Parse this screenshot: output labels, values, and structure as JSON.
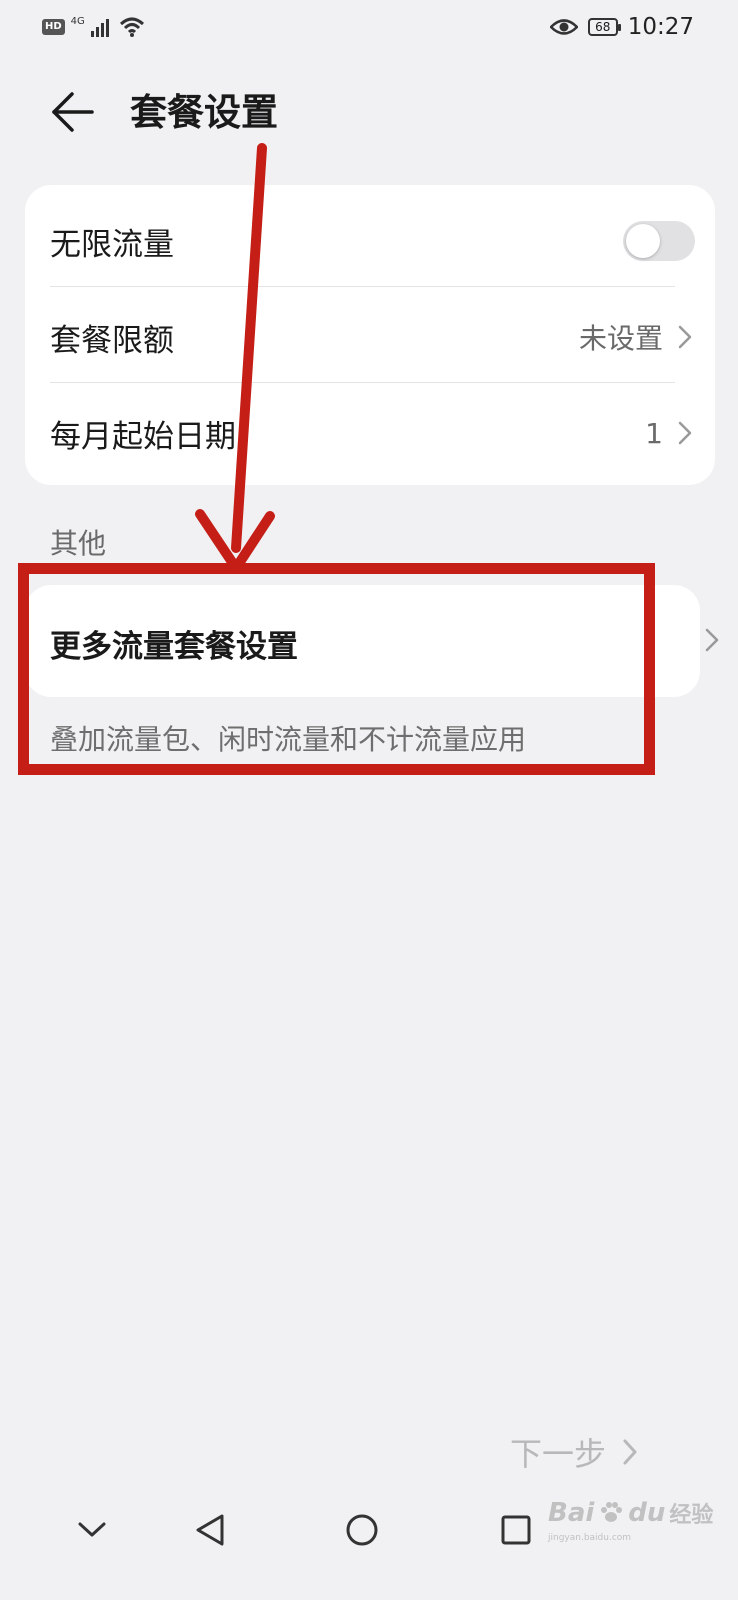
{
  "status_bar": {
    "hd": "HD",
    "network": "4G",
    "battery": "68",
    "time": "10:27",
    "icons": [
      "hd-icon",
      "signal-icon",
      "wifi-icon",
      "eye-icon",
      "battery-icon"
    ]
  },
  "header": {
    "back_icon": "back-arrow-icon",
    "title": "套餐设置"
  },
  "main_card": {
    "unlimited": {
      "label": "无限流量",
      "toggle_on": false
    },
    "quota": {
      "label": "套餐限额",
      "value": "未设置"
    },
    "start_date": {
      "label": "每月起始日期",
      "value": "1"
    }
  },
  "other_section": {
    "title": "其他",
    "more_settings": {
      "label": "更多流量套餐设置",
      "description": "叠加流量包、闲时流量和不计流量应用"
    }
  },
  "next_button": {
    "label": "下一步"
  },
  "annotation": {
    "arrow_color": "#c41e16",
    "box_color": "#c41e16"
  },
  "watermark": {
    "text": "Bai",
    "icon": "paw-icon",
    "suffix": "du",
    "cn": "经验",
    "url": "jingyan.baidu.com"
  },
  "nav_bar": {
    "icons": [
      "chevron-down-icon",
      "nav-back-icon",
      "home-icon",
      "recents-icon"
    ]
  }
}
